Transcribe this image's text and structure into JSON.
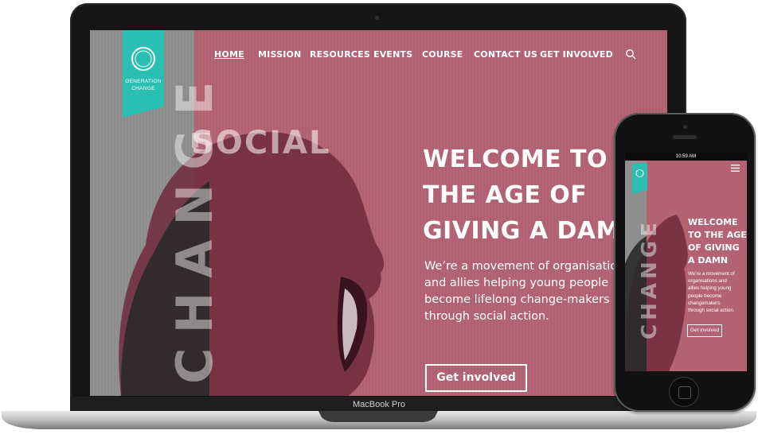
{
  "site": {
    "logo_text_line1": "GENERATION",
    "logo_text_line2": "CHANGE",
    "nav": [
      {
        "label": "HOME"
      },
      {
        "label": "MISSION"
      },
      {
        "label": "RESOURCES"
      },
      {
        "label": "EVENTS"
      },
      {
        "label": "COURSE"
      },
      {
        "label": "CONTACT US"
      },
      {
        "label": "GET INVOLVED"
      }
    ],
    "big_word_top": "SOCIAL",
    "big_word_vertical": "CHANGE",
    "hero": {
      "title_line1": "WELCOME TO",
      "title_line2": "THE AGE OF",
      "title_line3": "GIVING A DAMN",
      "body_line1": "We’re a movement of organisations",
      "body_line2": "and allies helping young people",
      "body_line3": "become lifelong change-makers",
      "body_line4": "through social action.",
      "button": "Get involved"
    }
  },
  "laptop": {
    "model_label": "MacBook Pro"
  },
  "phone": {
    "time": "10:59 AM",
    "title_line1": "WELCOME",
    "title_line2": "TO THE AGE",
    "title_line3": "OF GIVING",
    "title_line4": "A DAMN",
    "body_line1": "We’re a movement of",
    "body_line2": "organisations and",
    "body_line3": "allies helping young",
    "body_line4": "people become",
    "body_line5": "changemakers",
    "body_line6": "through social action.",
    "button": "Get involved",
    "vertical_word": "CHANGE"
  },
  "colors": {
    "accent_teal": "#2bbfb3",
    "hero_pink": "#b46373",
    "grey_panel": "#8f8f8f"
  },
  "icons": [
    "search-icon",
    "menu-icon",
    "logo-ring-icon"
  ]
}
